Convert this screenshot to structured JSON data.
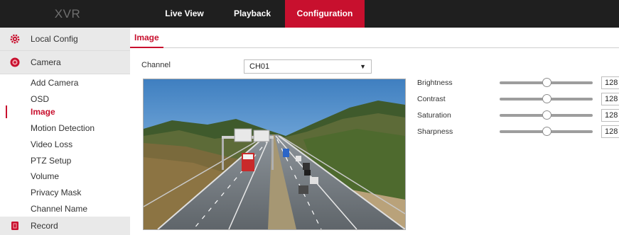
{
  "header": {
    "brand": "XVR",
    "tabs": [
      {
        "label": "Live View",
        "active": false
      },
      {
        "label": "Playback",
        "active": false
      },
      {
        "label": "Configuration",
        "active": true
      }
    ],
    "active_color": "#c8102e"
  },
  "sidebar": {
    "sections": [
      {
        "label": "Local Config",
        "icon": "gear-icon"
      },
      {
        "label": "Camera",
        "icon": "camera-icon"
      },
      {
        "label": "Record",
        "icon": "record-icon"
      }
    ],
    "camera_items": [
      "Add Camera",
      "OSD",
      "Image",
      "Motion Detection",
      "Video Loss",
      "PTZ Setup",
      "Volume",
      "Privacy Mask",
      "Channel Name"
    ],
    "active_item": "Image"
  },
  "main": {
    "tab": "Image",
    "channel": {
      "label": "Channel",
      "value": "CH01"
    },
    "adjustments": [
      {
        "label": "Brightness",
        "value": "128",
        "level": 0.5
      },
      {
        "label": "Contrast",
        "value": "128",
        "level": 0.5
      },
      {
        "label": "Saturation",
        "value": "128",
        "level": 0.5
      },
      {
        "label": "Sharpness",
        "value": "128",
        "level": 0.5
      }
    ]
  }
}
